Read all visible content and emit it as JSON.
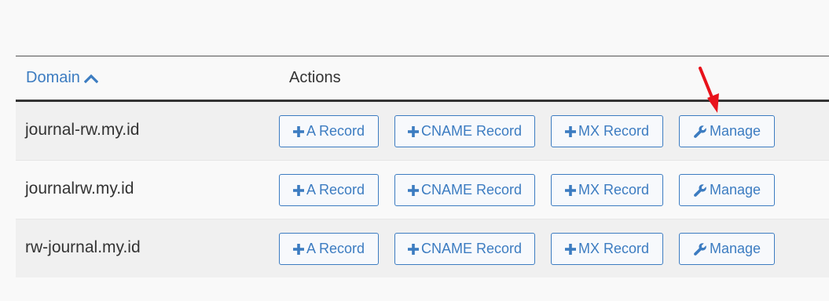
{
  "table": {
    "header": {
      "domain_label": "Domain",
      "actions_label": "Actions"
    },
    "rows": [
      {
        "domain": "journal-rw.my.id",
        "a_record": "A Record",
        "cname_record": "CNAME Record",
        "mx_record": "MX Record",
        "manage": "Manage"
      },
      {
        "domain": "journalrw.my.id",
        "a_record": "A Record",
        "cname_record": "CNAME Record",
        "mx_record": "MX Record",
        "manage": "Manage"
      },
      {
        "domain": "rw-journal.my.id",
        "a_record": "A Record",
        "cname_record": "CNAME Record",
        "mx_record": "MX Record",
        "manage": "Manage"
      }
    ]
  },
  "icons": {
    "sort": "chevron-up-icon",
    "add": "plus-icon",
    "manage": "wrench-icon",
    "annotation": "red-arrow"
  },
  "colors": {
    "link": "#3c7cc1",
    "annotation": "#e8121b"
  }
}
